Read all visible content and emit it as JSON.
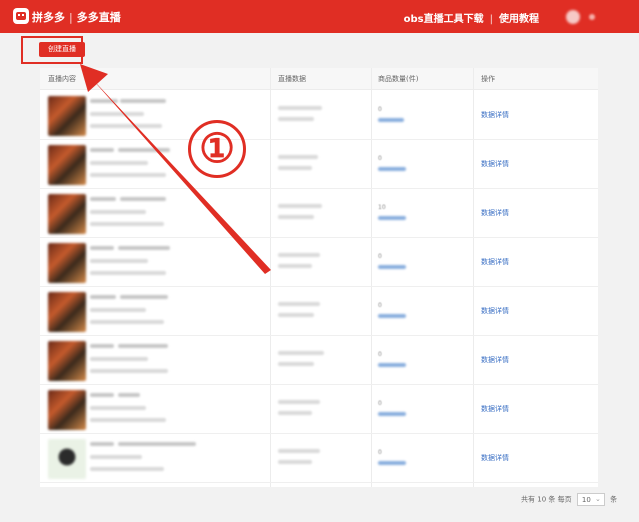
{
  "header": {
    "logo_icon": "pinduoduo-logo-icon",
    "brand_name": "拼多多",
    "brand_divider": "|",
    "product_name": "多多直播",
    "nav_obs": "obs直播工具下载",
    "nav_divider": "|",
    "nav_tutorial": "使用教程",
    "brand_color": "#e02e24"
  },
  "toolbar": {
    "create_label": "创建直播"
  },
  "table": {
    "columns": [
      "直播内容",
      "直播数据",
      "商品数量(件)",
      "操作"
    ],
    "rows": [
      {
        "count": "0",
        "action": "数据详情"
      },
      {
        "count": "0",
        "action": "数据详情"
      },
      {
        "count": "10",
        "action": "数据详情"
      },
      {
        "count": "0",
        "action": "数据详情"
      },
      {
        "count": "0",
        "action": "数据详情"
      },
      {
        "count": "0",
        "action": "数据详情"
      },
      {
        "count": "0",
        "action": "数据详情"
      },
      {
        "count": "0",
        "action": "数据详情"
      }
    ]
  },
  "annotation": {
    "step_number": "①",
    "color": "#e02e24"
  },
  "pagination": {
    "total_prefix": "共有",
    "total": "10",
    "total_suffix": "条",
    "per_page_label": "每页",
    "per_page_value": "10",
    "per_page_suffix": "条"
  }
}
